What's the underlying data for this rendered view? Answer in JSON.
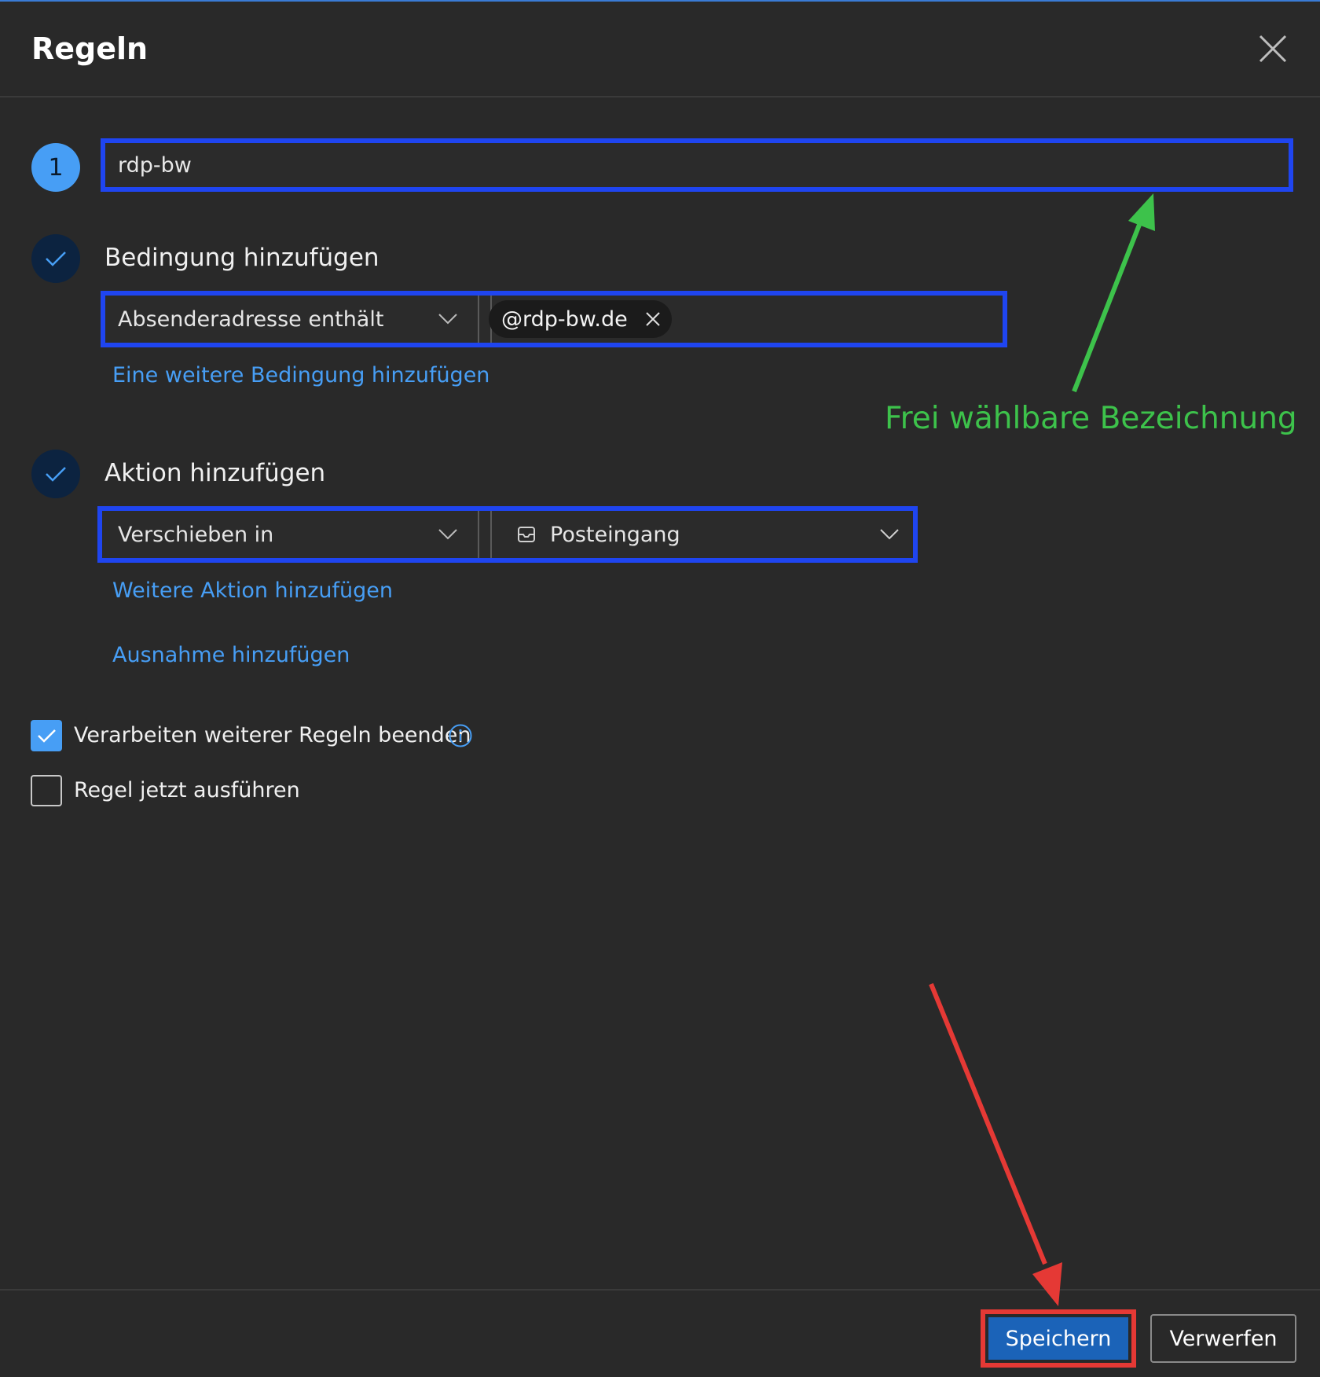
{
  "dialog": {
    "title": "Regeln",
    "close_icon": "close-icon"
  },
  "step1": {
    "number": "1",
    "name_value": "rdp-bw"
  },
  "condition": {
    "title": "Bedingung hinzufügen",
    "field_label": "Absenderadresse enthält",
    "chip_value": "@rdp-bw.de",
    "add_link": "Eine weitere Bedingung hinzufügen"
  },
  "action": {
    "title": "Aktion hinzufügen",
    "type_label": "Verschieben in",
    "folder_label": "Posteingang",
    "folder_icon": "inbox-icon",
    "add_link": "Weitere Aktion hinzufügen",
    "exception_link": "Ausnahme hinzufügen"
  },
  "options": {
    "stop_processing": {
      "label": "Verarbeiten weiterer Regeln beenden",
      "checked": true
    },
    "run_now": {
      "label": "Regel jetzt ausführen",
      "checked": false
    }
  },
  "footer": {
    "save_label": "Speichern",
    "discard_label": "Verwerfen"
  },
  "annotations": {
    "green_text": "Frei wählbare Bezeichnung",
    "green_color": "#3dc24b",
    "red_color": "#e53935",
    "highlight_color": "#1f45f0"
  },
  "theme": {
    "background": "#292929",
    "accent": "#479ef5",
    "primary_button": "#1b63b8"
  }
}
